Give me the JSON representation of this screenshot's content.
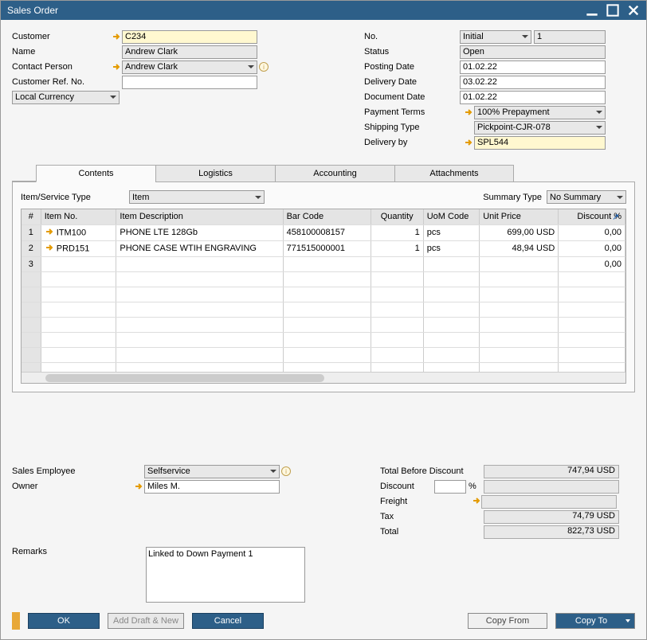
{
  "window": {
    "title": "Sales Order"
  },
  "leftForm": {
    "customer_label": "Customer",
    "customer": "C234",
    "name_label": "Name",
    "name": "Andrew Clark",
    "contact_label": "Contact Person",
    "contact": "Andrew Clark",
    "custref_label": "Customer Ref. No.",
    "custref": "",
    "currency": "Local Currency"
  },
  "rightForm": {
    "no_label": "No.",
    "no_series": "Initial",
    "no_value": "1",
    "status_label": "Status",
    "status": "Open",
    "posting_label": "Posting Date",
    "posting": "01.02.22",
    "delivery_label": "Delivery Date",
    "delivery": "03.02.22",
    "document_label": "Document Date",
    "document": "01.02.22",
    "payment_label": "Payment Terms",
    "payment": "100% Prepayment",
    "shipping_label": "Shipping Type",
    "shipping": "Pickpoint-CJR-078",
    "deliveryby_label": "Delivery by",
    "deliveryby": "SPL544"
  },
  "tabs": {
    "contents": "Contents",
    "logistics": "Logistics",
    "accounting": "Accounting",
    "attachments": "Attachments"
  },
  "tabTop": {
    "itemservice_label": "Item/Service Type",
    "itemservice": "Item",
    "summary_label": "Summary Type",
    "summary": "No Summary"
  },
  "grid": {
    "headers": {
      "num": "#",
      "itemno": "Item No.",
      "desc": "Item Description",
      "barcode": "Bar Code",
      "qty": "Quantity",
      "uom": "UoM Code",
      "price": "Unit Price",
      "disc": "Discount %"
    },
    "rows": [
      {
        "num": "1",
        "itemno": "ITM100",
        "desc": "PHONE LTE 128Gb",
        "barcode": "458100008157",
        "qty": "1",
        "uom": "pcs",
        "price": "699,00 USD",
        "disc": "0,00"
      },
      {
        "num": "2",
        "itemno": "PRD151",
        "desc": "PHONE CASE WTIH ENGRAVING",
        "barcode": "771515000001",
        "qty": "1",
        "uom": "pcs",
        "price": "48,94 USD",
        "disc": "0,00"
      },
      {
        "num": "3",
        "itemno": "",
        "desc": "",
        "barcode": "",
        "qty": "",
        "uom": "",
        "price": "",
        "disc": "0,00"
      }
    ]
  },
  "bottomLeft": {
    "salesemp_label": "Sales Employee",
    "salesemp": "Selfservice",
    "owner_label": "Owner",
    "owner": "Miles M.",
    "remarks_label": "Remarks",
    "remarks": "Linked to Down Payment 1"
  },
  "totals": {
    "tbd_label": "Total Before Discount",
    "tbd": "747,94 USD",
    "discount_label": "Discount",
    "discount_pct": "",
    "pct_sign": "%",
    "discount_val": "",
    "freight_label": "Freight",
    "freight": "",
    "tax_label": "Tax",
    "tax": "74,79 USD",
    "total_label": "Total",
    "total": "822,73 USD"
  },
  "footer": {
    "ok": "OK",
    "adddraft": "Add Draft & New",
    "cancel": "Cancel",
    "copyfrom": "Copy From",
    "copyto": "Copy To"
  }
}
